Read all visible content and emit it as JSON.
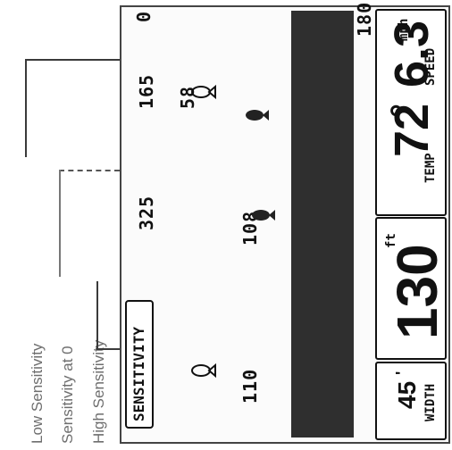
{
  "labels": {
    "low": "Low Sensitivity",
    "zero": "Sensitivity at 0",
    "high": "High Sensitivity"
  },
  "screen": {
    "sensitivity_badge": "SENSITIVITY",
    "depth_top": "0",
    "depth_bottom": "180",
    "markers": [
      "165",
      "325",
      "110"
    ],
    "fish_depths": [
      "58",
      "108",
      "110"
    ],
    "speed": {
      "value": "6.3",
      "unit": "mph",
      "label": "SPEED"
    },
    "temp": {
      "value": "72",
      "unit": "°",
      "label": "TEMP"
    },
    "depth": {
      "value": "130",
      "unit": "ft"
    },
    "width": {
      "value": "45",
      "unit": "'",
      "label": "WIDTH"
    }
  }
}
